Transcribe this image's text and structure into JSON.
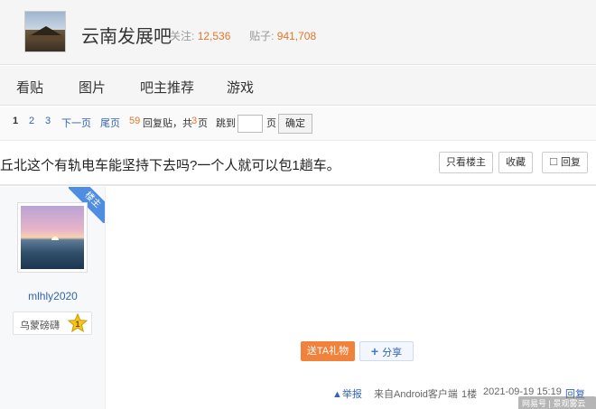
{
  "header": {
    "forum_name": "云南发展吧",
    "followers_label": "关注:",
    "followers": "12,536",
    "posts_label": "贴子:",
    "posts": "941,708"
  },
  "nav": {
    "items": [
      "看贴",
      "图片",
      "吧主推荐",
      "游戏"
    ]
  },
  "pager": {
    "current": "1",
    "page2": "2",
    "page3": "3",
    "next": "下一页",
    "last": "尾页",
    "reply_count": "59",
    "reply_label": "回复贴，共",
    "page_count": "3",
    "page_unit": "页",
    "jump_label": "跳到",
    "jump_unit": "页",
    "confirm": "确定"
  },
  "thread": {
    "title": "丘北这个有轨电车能坚持下去吗?一个人就可以包1趟车。",
    "only_op": "只看楼主",
    "favorite": "收藏",
    "reply": "回复"
  },
  "author": {
    "ribbon": "楼主",
    "username": "mlhly2020",
    "badge_name": "乌蒙磅礴",
    "badge_level": "1"
  },
  "post": {
    "gift": "送TA礼物",
    "share": "分享",
    "report": "举报",
    "source": "来自Android客户端",
    "floor": "1楼",
    "time": "2021-09-19 15:19",
    "reply": "回复"
  },
  "watermark": "网易号 | 景观雾云之南"
}
